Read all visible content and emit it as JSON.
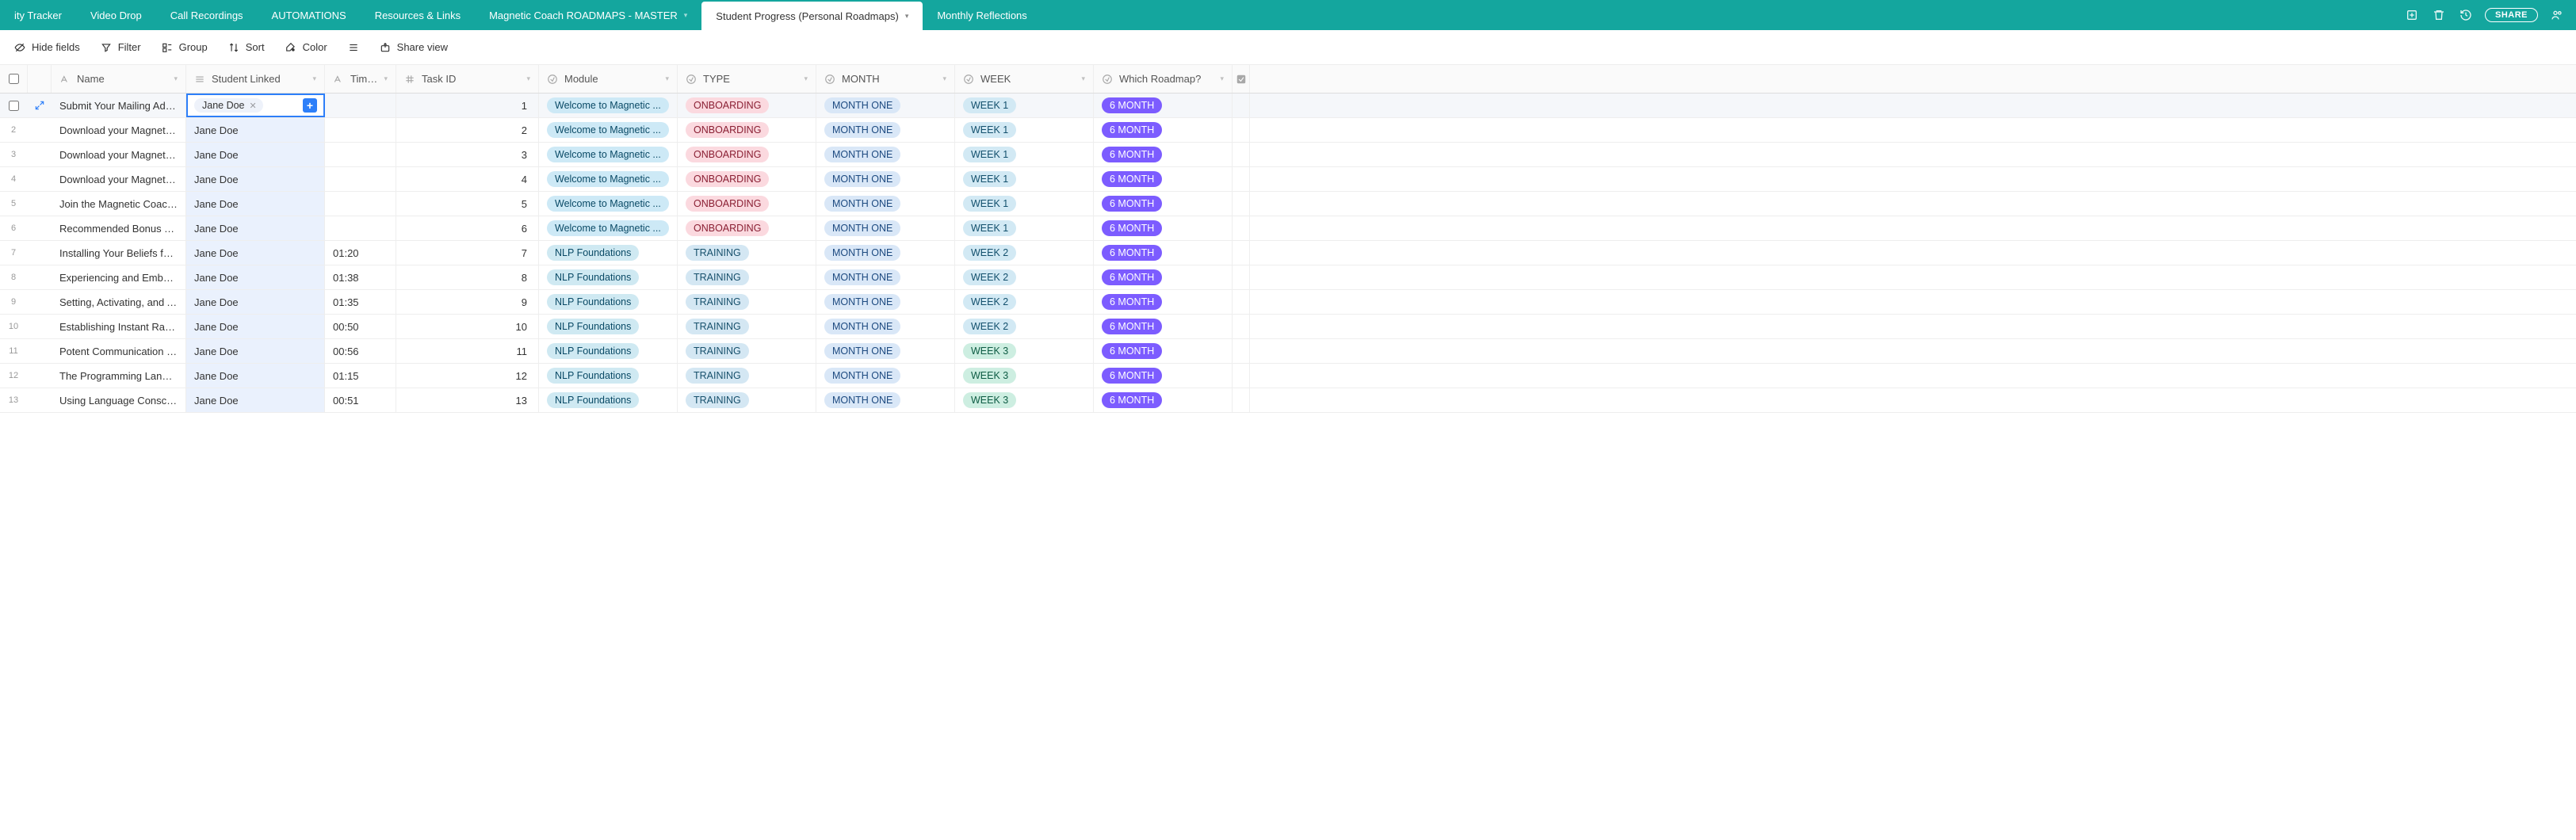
{
  "tabs": [
    {
      "label": "ity Tracker",
      "active": false,
      "caret": false
    },
    {
      "label": "Video Drop",
      "active": false,
      "caret": false
    },
    {
      "label": "Call Recordings",
      "active": false,
      "caret": false
    },
    {
      "label": "AUTOMATIONS",
      "active": false,
      "caret": false
    },
    {
      "label": "Resources & Links",
      "active": false,
      "caret": false
    },
    {
      "label": "Magnetic Coach ROADMAPS - MASTER",
      "active": false,
      "caret": true
    },
    {
      "label": "Student Progress (Personal Roadmaps)",
      "active": true,
      "caret": true
    },
    {
      "label": "Monthly Reflections",
      "active": false,
      "caret": false
    }
  ],
  "share_label": "SHARE",
  "toolbar": {
    "hide_fields": "Hide fields",
    "filter": "Filter",
    "group": "Group",
    "sort": "Sort",
    "color": "Color",
    "share_view": "Share view"
  },
  "columns": {
    "name": "Name",
    "student": "Student Linked",
    "time": "Time ...",
    "task": "Task ID",
    "module": "Module",
    "type": "TYPE",
    "month": "MONTH",
    "week": "WEEK",
    "roadmap": "Which Roadmap?"
  },
  "rows": [
    {
      "num": "1",
      "selected": true,
      "name": "Submit Your Mailing Addr...",
      "student": "Jane Doe",
      "time": "",
      "task": "1",
      "module": "Welcome to Magnetic ...",
      "module_cls": "p-welcome",
      "type": "ONBOARDING",
      "type_cls": "p-onboard",
      "month": "MONTH ONE",
      "week": "WEEK 1",
      "week_cls": "p-week1",
      "roadmap": "6 MONTH"
    },
    {
      "num": "2",
      "name": "Download your Magnetic ...",
      "student": "Jane Doe",
      "time": "",
      "task": "2",
      "module": "Welcome to Magnetic ...",
      "module_cls": "p-welcome",
      "type": "ONBOARDING",
      "type_cls": "p-onboard",
      "month": "MONTH ONE",
      "week": "WEEK 1",
      "week_cls": "p-week1",
      "roadmap": "6 MONTH"
    },
    {
      "num": "3",
      "name": "Download your Magnetic ...",
      "student": "Jane Doe",
      "time": "",
      "task": "3",
      "module": "Welcome to Magnetic ...",
      "module_cls": "p-welcome",
      "type": "ONBOARDING",
      "type_cls": "p-onboard",
      "month": "MONTH ONE",
      "week": "WEEK 1",
      "week_cls": "p-week1",
      "roadmap": "6 MONTH"
    },
    {
      "num": "4",
      "name": "Download your Magnetic ...",
      "student": "Jane Doe",
      "time": "",
      "task": "4",
      "module": "Welcome to Magnetic ...",
      "module_cls": "p-welcome",
      "type": "ONBOARDING",
      "type_cls": "p-onboard",
      "month": "MONTH ONE",
      "week": "WEEK 1",
      "week_cls": "p-week1",
      "roadmap": "6 MONTH"
    },
    {
      "num": "5",
      "name": "Join the Magnetic Coach...",
      "student": "Jane Doe",
      "time": "",
      "task": "5",
      "module": "Welcome to Magnetic ...",
      "module_cls": "p-welcome",
      "type": "ONBOARDING",
      "type_cls": "p-onboard",
      "month": "MONTH ONE",
      "week": "WEEK 1",
      "week_cls": "p-week1",
      "roadmap": "6 MONTH"
    },
    {
      "num": "6",
      "name": "Recommended Bonus Tra...",
      "student": "Jane Doe",
      "time": "",
      "task": "6",
      "module": "Welcome to Magnetic ...",
      "module_cls": "p-welcome",
      "type": "ONBOARDING",
      "type_cls": "p-onboard",
      "month": "MONTH ONE",
      "week": "WEEK 1",
      "week_cls": "p-week1",
      "roadmap": "6 MONTH"
    },
    {
      "num": "7",
      "name": "Installing Your Beliefs for ...",
      "student": "Jane Doe",
      "time": "01:20",
      "task": "7",
      "module": "NLP Foundations",
      "module_cls": "p-nlp",
      "type": "TRAINING",
      "type_cls": "p-training",
      "month": "MONTH ONE",
      "week": "WEEK 2",
      "week_cls": "p-week2",
      "roadmap": "6 MONTH"
    },
    {
      "num": "8",
      "name": "Experiencing and Embod...",
      "student": "Jane Doe",
      "time": "01:38",
      "task": "8",
      "module": "NLP Foundations",
      "module_cls": "p-nlp",
      "type": "TRAINING",
      "type_cls": "p-training",
      "month": "MONTH ONE",
      "week": "WEEK 2",
      "week_cls": "p-week2",
      "roadmap": "6 MONTH"
    },
    {
      "num": "9",
      "name": "Setting, Activating, and A...",
      "student": "Jane Doe",
      "time": "01:35",
      "task": "9",
      "module": "NLP Foundations",
      "module_cls": "p-nlp",
      "type": "TRAINING",
      "type_cls": "p-training",
      "month": "MONTH ONE",
      "week": "WEEK 2",
      "week_cls": "p-week2",
      "roadmap": "6 MONTH"
    },
    {
      "num": "10",
      "name": "Establishing Instant Rapp...",
      "student": "Jane Doe",
      "time": "00:50",
      "task": "10",
      "module": "NLP Foundations",
      "module_cls": "p-nlp",
      "type": "TRAINING",
      "type_cls": "p-training",
      "month": "MONTH ONE",
      "week": "WEEK 2",
      "week_cls": "p-week2",
      "roadmap": "6 MONTH"
    },
    {
      "num": "11",
      "name": "Potent Communication C...",
      "student": "Jane Doe",
      "time": "00:56",
      "task": "11",
      "module": "NLP Foundations",
      "module_cls": "p-nlp",
      "type": "TRAINING",
      "type_cls": "p-training",
      "month": "MONTH ONE",
      "week": "WEEK 3",
      "week_cls": "p-week3",
      "roadmap": "6 MONTH"
    },
    {
      "num": "12",
      "name": "The Programming Langua...",
      "student": "Jane Doe",
      "time": "01:15",
      "task": "12",
      "module": "NLP Foundations",
      "module_cls": "p-nlp",
      "type": "TRAINING",
      "type_cls": "p-training",
      "month": "MONTH ONE",
      "week": "WEEK 3",
      "week_cls": "p-week3",
      "roadmap": "6 MONTH"
    },
    {
      "num": "13",
      "name": "Using Language Conscio...",
      "student": "Jane Doe",
      "time": "00:51",
      "task": "13",
      "module": "NLP Foundations",
      "module_cls": "p-nlp",
      "type": "TRAINING",
      "type_cls": "p-training",
      "month": "MONTH ONE",
      "week": "WEEK 3",
      "week_cls": "p-week3",
      "roadmap": "6 MONTH"
    }
  ]
}
